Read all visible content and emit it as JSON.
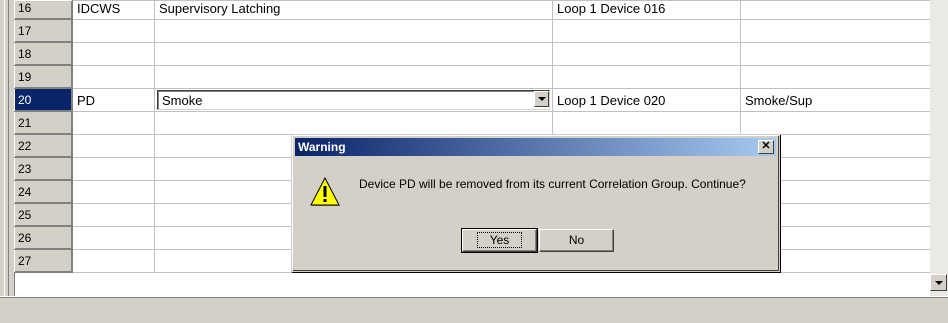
{
  "grid": {
    "rows": [
      {
        "num": "16",
        "type": "IDCWS",
        "desc": "Supervisory Latching",
        "addr": "Loop 1 Device 016",
        "label": ""
      },
      {
        "num": "17",
        "type": "",
        "desc": "",
        "addr": "",
        "label": ""
      },
      {
        "num": "18",
        "type": "",
        "desc": "",
        "addr": "",
        "label": ""
      },
      {
        "num": "19",
        "type": "",
        "desc": "",
        "addr": "",
        "label": ""
      },
      {
        "num": "20",
        "type": "PD",
        "desc": "Smoke",
        "addr": "Loop 1 Device 020",
        "label": "Smoke/Sup"
      },
      {
        "num": "21",
        "type": "",
        "desc": "",
        "addr": "",
        "label": ""
      },
      {
        "num": "22",
        "type": "",
        "desc": "",
        "addr": "",
        "label": ""
      },
      {
        "num": "23",
        "type": "",
        "desc": "",
        "addr": "",
        "label": ""
      },
      {
        "num": "24",
        "type": "",
        "desc": "",
        "addr": "",
        "label": ""
      },
      {
        "num": "25",
        "type": "",
        "desc": "",
        "addr": "",
        "label": ""
      },
      {
        "num": "26",
        "type": "",
        "desc": "",
        "addr": "",
        "label": ""
      },
      {
        "num": "27",
        "type": "",
        "desc": "",
        "addr": "",
        "label": ""
      }
    ]
  },
  "dialog": {
    "title": "Warning",
    "icon": "warning-icon",
    "message": "Device PD will be removed from its current Correlation Group. Continue?",
    "yes_label": "Yes",
    "no_label": "No",
    "close_glyph": "✕"
  },
  "colors": {
    "selected_row": "#0a246a",
    "chrome": "#d4d0c8"
  }
}
